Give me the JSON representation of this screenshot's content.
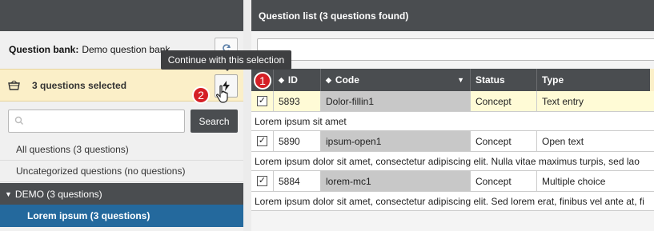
{
  "left_panel": {
    "question_bank_label": "Question bank:",
    "question_bank_name": "Demo question bank",
    "selection_text": "3 questions selected",
    "search_placeholder": "",
    "search_button": "Search",
    "categories": [
      {
        "label": "All questions (3 questions)"
      },
      {
        "label": "Uncategorized questions (no questions)"
      }
    ],
    "demo_category": "DEMO (3 questions)",
    "selected_category": "Lorem ipsum (3 questions)"
  },
  "tooltip": "Continue with this selection",
  "badges": {
    "one": "1",
    "two": "2"
  },
  "right_panel": {
    "title": "Question list  (3 questions found)",
    "search_placeholder": "",
    "columns": {
      "id": "ID",
      "code": "Code",
      "status": "Status",
      "type": "Type"
    },
    "rows": [
      {
        "checked": "✓",
        "id": "5893",
        "code": "Dolor-fillin1",
        "status": "Concept",
        "type": "Text entry",
        "description": "Lorem ipsum sit amet"
      },
      {
        "checked": "✓",
        "id": "5890",
        "code": "ipsum-open1",
        "status": "Concept",
        "type": "Open text",
        "description": "Lorem ipsum dolor sit amet, consectetur adipiscing elit. Nulla vitae maximus turpis, sed lao"
      },
      {
        "checked": "✓",
        "id": "5884",
        "code": "lorem-mc1",
        "status": "Concept",
        "type": "Multiple choice",
        "description": "Lorem ipsum dolor sit amet, consectetur adipiscing elit. Sed lorem erat, finibus vel ante at, fi"
      }
    ]
  },
  "colors": {
    "dark_bar": "#4a4d50",
    "selected_blue": "#24699d",
    "highlight_yellow": "#fbefc8",
    "badge_red": "#d51f26"
  },
  "icons": [
    "basket-icon",
    "bolt-icon",
    "search-icon",
    "cursor-hand-icon",
    "sort-icon",
    "checkbox-icon"
  ]
}
